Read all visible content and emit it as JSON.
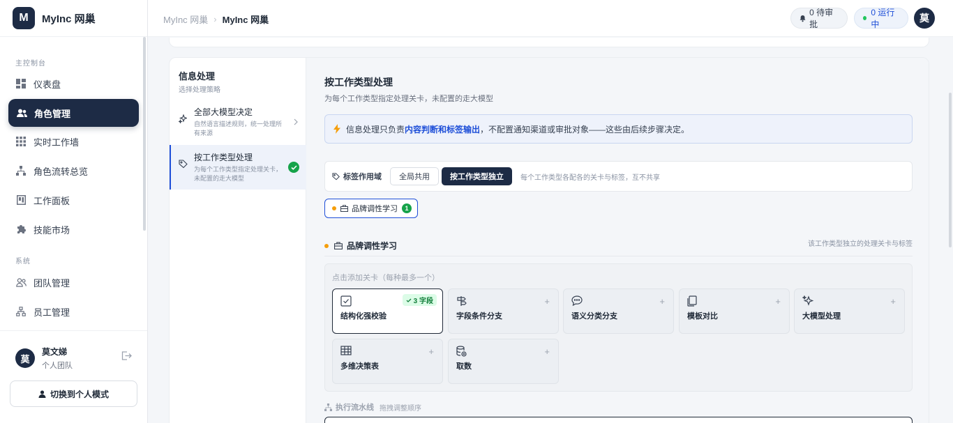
{
  "brand": {
    "logo_letter": "M",
    "name": "MyInc 网巢"
  },
  "sidebar": {
    "section_main": "主控制台",
    "section_system": "系统",
    "items": [
      {
        "label": "仪表盘",
        "icon": "dashboard-icon"
      },
      {
        "label": "角色管理",
        "icon": "users-icon",
        "active": true
      },
      {
        "label": "实时工作墙",
        "icon": "grid-icon"
      },
      {
        "label": "角色流转总览",
        "icon": "flow-icon"
      },
      {
        "label": "工作面板",
        "icon": "board-icon"
      },
      {
        "label": "技能市场",
        "icon": "puzzle-icon"
      },
      {
        "label": "团队管理",
        "icon": "team-icon"
      },
      {
        "label": "员工管理",
        "icon": "org-icon"
      }
    ]
  },
  "user": {
    "avatar": "莫",
    "name": "莫文娣",
    "team": "个人团队",
    "switch_label": "切换到个人模式"
  },
  "header": {
    "breadcrumb": [
      "MyInc 网巢",
      "MyInc 网巢"
    ],
    "pending": "0 待审批",
    "running": "0 运行中",
    "avatar": "莫"
  },
  "left_panel": {
    "title": "信息处理",
    "subtitle": "选择处理策略",
    "options": [
      {
        "title": "全部大模型决定",
        "desc": "自然语言描述规则，统一处理所有来源"
      },
      {
        "title": "按工作类型处理",
        "desc": "为每个工作类型指定处理关卡，未配置的走大模型",
        "selected": true
      }
    ]
  },
  "right_panel": {
    "title": "按工作类型处理",
    "subtitle": "为每个工作类型指定处理关卡，未配置的走大模型",
    "info": {
      "prefix": "信息处理只负责",
      "highlight": "内容判断和标签输出",
      "suffix": "，不配置通知渠道或审批对象——这些由后续步骤决定。"
    },
    "scope": {
      "label": "标签作用域",
      "options": [
        "全局共用",
        "按工作类型独立"
      ],
      "selected": "按工作类型独立",
      "hint": "每个工作类型各配各的关卡与标签，互不共享"
    },
    "type_chip": {
      "label": "品牌调性学习",
      "count": "1"
    },
    "section": {
      "title": "品牌调性学习",
      "hint": "该工作类型独立的处理关卡与标签"
    },
    "cards_hint": "点击添加关卡（每种最多一个）",
    "cards": [
      {
        "label": "结构化强校验",
        "icon": "checkbox-icon",
        "active": true,
        "badge": "3 字段"
      },
      {
        "label": "字段条件分支",
        "icon": "signpost-icon"
      },
      {
        "label": "语义分类分支",
        "icon": "chat-icon"
      },
      {
        "label": "模板对比",
        "icon": "copy-icon"
      },
      {
        "label": "大模型处理",
        "icon": "sparkles-icon"
      },
      {
        "label": "多维决策表",
        "icon": "table-icon"
      },
      {
        "label": "取数",
        "icon": "database-icon"
      }
    ],
    "pipeline": {
      "title": "执行流水线",
      "hint": "拖拽调整顺序"
    }
  },
  "colors": {
    "brand_dark": "#1d2b45",
    "accent_blue": "#1d4ed8",
    "success_green": "#16a34a",
    "warning_orange": "#f59e0b"
  }
}
